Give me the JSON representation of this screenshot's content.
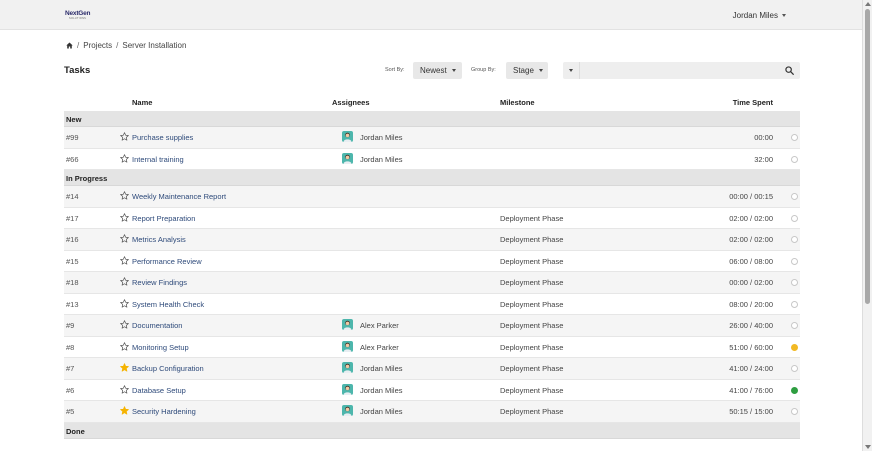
{
  "brand": {
    "logo_line1": "NextGen",
    "logo_line2": "SOLUTIONS"
  },
  "user": {
    "name": "Jordan Miles"
  },
  "breadcrumb": {
    "projects": "Projects",
    "current": "Server Installation"
  },
  "page_title": "Tasks",
  "toolbar": {
    "sort_label": "Sort By:",
    "sort_value": "Newest",
    "group_label": "Group By:",
    "group_value": "Stage",
    "search_value": ""
  },
  "columns": {
    "name": "Name",
    "assignees": "Assignees",
    "milestone": "Milestone",
    "time": "Time Spent"
  },
  "groups": [
    {
      "label": "New",
      "rows": [
        {
          "id": "#99",
          "starred": false,
          "name": "Purchase supplies",
          "assignee": "Jordan Miles",
          "milestone": "",
          "time": "00:00",
          "status": "none"
        },
        {
          "id": "#66",
          "starred": false,
          "name": "Internal training",
          "assignee": "Jordan Miles",
          "milestone": "",
          "time": "32:00",
          "status": "none"
        }
      ]
    },
    {
      "label": "In Progress",
      "rows": [
        {
          "id": "#14",
          "starred": false,
          "name": "Weekly Maintenance Report",
          "assignee": "",
          "milestone": "",
          "time": "00:00 / 00:15",
          "status": "none"
        },
        {
          "id": "#17",
          "starred": false,
          "name": "Report Preparation",
          "assignee": "",
          "milestone": "Deployment Phase",
          "time": "02:00 / 02:00",
          "status": "none"
        },
        {
          "id": "#16",
          "starred": false,
          "name": "Metrics Analysis",
          "assignee": "",
          "milestone": "Deployment Phase",
          "time": "02:00 / 02:00",
          "status": "none"
        },
        {
          "id": "#15",
          "starred": false,
          "name": "Performance Review",
          "assignee": "",
          "milestone": "Deployment Phase",
          "time": "06:00 / 08:00",
          "status": "none"
        },
        {
          "id": "#18",
          "starred": false,
          "name": "Review Findings",
          "assignee": "",
          "milestone": "Deployment Phase",
          "time": "00:00 / 02:00",
          "status": "none"
        },
        {
          "id": "#13",
          "starred": false,
          "name": "System Health Check",
          "assignee": "",
          "milestone": "Deployment Phase",
          "time": "08:00 / 20:00",
          "status": "none"
        },
        {
          "id": "#9",
          "starred": false,
          "name": "Documentation",
          "assignee": "Alex Parker",
          "milestone": "Deployment Phase",
          "time": "26:00 / 40:00",
          "status": "none"
        },
        {
          "id": "#8",
          "starred": false,
          "name": "Monitoring Setup",
          "assignee": "Alex Parker",
          "milestone": "Deployment Phase",
          "time": "51:00 / 60:00",
          "status": "yellow"
        },
        {
          "id": "#7",
          "starred": true,
          "name": "Backup Configuration",
          "assignee": "Jordan Miles",
          "milestone": "Deployment Phase",
          "time": "41:00 / 24:00",
          "status": "none"
        },
        {
          "id": "#6",
          "starred": false,
          "name": "Database Setup",
          "assignee": "Jordan Miles",
          "milestone": "Deployment Phase",
          "time": "41:00 / 76:00",
          "status": "green"
        },
        {
          "id": "#5",
          "starred": true,
          "name": "Security Hardening",
          "assignee": "Jordan Miles",
          "milestone": "Deployment Phase",
          "time": "50:15 / 15:00",
          "status": "none"
        }
      ]
    },
    {
      "label": "Done",
      "rows": []
    }
  ],
  "colors": {
    "star_active": "#f5b301",
    "status_yellow": "#f2b924",
    "status_green": "#2e9e41",
    "link": "#2e4a7a"
  }
}
